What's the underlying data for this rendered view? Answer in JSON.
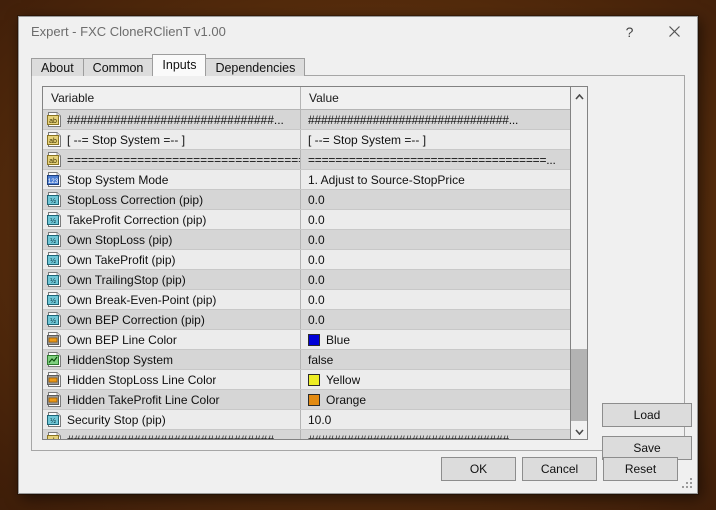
{
  "window": {
    "title": "Expert - FXC CloneRClienT v1.00",
    "help_glyph": "?",
    "close_glyph": "×"
  },
  "tabs": [
    {
      "label": "About",
      "active": false
    },
    {
      "label": "Common",
      "active": false
    },
    {
      "label": "Inputs",
      "active": true
    },
    {
      "label": "Dependencies",
      "active": false
    }
  ],
  "grid": {
    "columns": [
      "Variable",
      "Value"
    ],
    "rows": [
      {
        "icon": "string-type-icon",
        "variable": "###############################...",
        "value": "###############################...",
        "value_type": "text"
      },
      {
        "icon": "string-type-icon",
        "variable": "[ --= Stop System =-- ]",
        "value": "[ --= Stop System =-- ]",
        "value_type": "text"
      },
      {
        "icon": "string-type-icon",
        "variable": "===================================...",
        "value": "===================================...",
        "value_type": "text"
      },
      {
        "icon": "integer-type-icon",
        "variable": "Stop System Mode",
        "value": "1. Adjust to Source-StopPrice",
        "value_type": "text"
      },
      {
        "icon": "double-type-icon",
        "variable": "StopLoss Correction (pip)",
        "value": "0.0",
        "value_type": "text"
      },
      {
        "icon": "double-type-icon",
        "variable": "TakeProfit Correction (pip)",
        "value": "0.0",
        "value_type": "text"
      },
      {
        "icon": "double-type-icon",
        "variable": "Own StopLoss (pip)",
        "value": "0.0",
        "value_type": "text"
      },
      {
        "icon": "double-type-icon",
        "variable": "Own TakeProfit (pip)",
        "value": "0.0",
        "value_type": "text"
      },
      {
        "icon": "double-type-icon",
        "variable": "Own TrailingStop (pip)",
        "value": "0.0",
        "value_type": "text"
      },
      {
        "icon": "double-type-icon",
        "variable": "Own Break-Even-Point (pip)",
        "value": "0.0",
        "value_type": "text"
      },
      {
        "icon": "double-type-icon",
        "variable": "Own BEP Correction (pip)",
        "value": "0.0",
        "value_type": "text"
      },
      {
        "icon": "color-type-icon",
        "variable": "Own BEP Line Color",
        "value": "Blue",
        "value_type": "color",
        "swatch": "#0000D7"
      },
      {
        "icon": "bool-type-icon",
        "variable": "HiddenStop System",
        "value": "false",
        "value_type": "text"
      },
      {
        "icon": "color-type-icon",
        "variable": "Hidden StopLoss Line Color",
        "value": "Yellow",
        "value_type": "color",
        "swatch": "#EDED24"
      },
      {
        "icon": "color-type-icon",
        "variable": "Hidden TakeProfit Line Color",
        "value": "Orange",
        "value_type": "color",
        "swatch": "#E28A11"
      },
      {
        "icon": "double-type-icon",
        "variable": "Security Stop (pip)",
        "value": "10.0",
        "value_type": "text"
      },
      {
        "icon": "string-type-icon",
        "variable": "###############################...",
        "value": "###############################...",
        "value_type": "text"
      }
    ]
  },
  "side_buttons": {
    "load": "Load",
    "save": "Save"
  },
  "bottom_buttons": {
    "ok": "OK",
    "cancel": "Cancel",
    "reset": "Reset"
  }
}
